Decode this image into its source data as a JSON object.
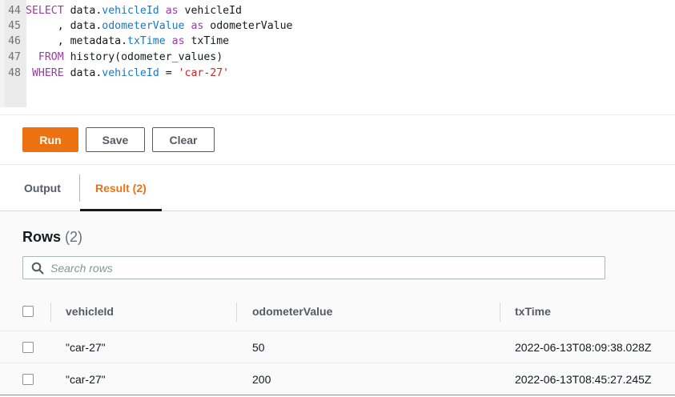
{
  "editor": {
    "lines": [
      {
        "num": "44",
        "tokens": [
          {
            "t": "SELECT",
            "c": "kw"
          },
          {
            "t": " data.",
            "c": "plain"
          },
          {
            "t": "vehicleId",
            "c": "prop"
          },
          {
            "t": " ",
            "c": "plain"
          },
          {
            "t": "as",
            "c": "kw"
          },
          {
            "t": " vehicleId",
            "c": "plain"
          }
        ]
      },
      {
        "num": "45",
        "tokens": [
          {
            "t": "     , data.",
            "c": "plain"
          },
          {
            "t": "odometerValue",
            "c": "prop"
          },
          {
            "t": " ",
            "c": "plain"
          },
          {
            "t": "as",
            "c": "kw"
          },
          {
            "t": " odometerValue",
            "c": "plain"
          }
        ]
      },
      {
        "num": "46",
        "tokens": [
          {
            "t": "     , metadata.",
            "c": "plain"
          },
          {
            "t": "txTime",
            "c": "prop"
          },
          {
            "t": " ",
            "c": "plain"
          },
          {
            "t": "as",
            "c": "kw"
          },
          {
            "t": " txTime",
            "c": "plain"
          }
        ]
      },
      {
        "num": "47",
        "tokens": [
          {
            "t": "  ",
            "c": "plain"
          },
          {
            "t": "FROM",
            "c": "kw"
          },
          {
            "t": " history(odometer_values)",
            "c": "plain"
          }
        ]
      },
      {
        "num": "48",
        "tokens": [
          {
            "t": " ",
            "c": "plain"
          },
          {
            "t": "WHERE",
            "c": "kw"
          },
          {
            "t": " data.",
            "c": "plain"
          },
          {
            "t": "vehicleId",
            "c": "prop"
          },
          {
            "t": " = ",
            "c": "plain"
          },
          {
            "t": "'car-27'",
            "c": "str"
          }
        ]
      }
    ]
  },
  "buttons": {
    "run": "Run",
    "save": "Save",
    "clear": "Clear"
  },
  "tabs": {
    "output": "Output",
    "result": "Result (2)"
  },
  "results": {
    "title": "Rows",
    "count": "(2)",
    "search_placeholder": "Search rows",
    "columns": [
      "vehicleId",
      "odometerValue",
      "txTime"
    ],
    "rows": [
      [
        "\"car-27\"",
        "50",
        "2022-06-13T08:09:38.028Z"
      ],
      [
        "\"car-27\"",
        "200",
        "2022-06-13T08:45:27.245Z"
      ]
    ]
  },
  "colors": {
    "accent": "#ec7211",
    "keyword": "#9a3ba8",
    "property": "#1b77c2",
    "string": "#c72a2a"
  }
}
